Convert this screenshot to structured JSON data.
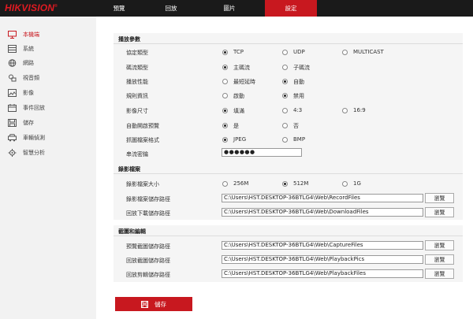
{
  "brand": {
    "name": "HIKVISION",
    "mark": "®"
  },
  "nav": {
    "tabs": [
      {
        "label": "預覽"
      },
      {
        "label": "回放"
      },
      {
        "label": "圖片"
      },
      {
        "label": "設定"
      }
    ]
  },
  "sidebar": {
    "items": [
      {
        "label": "本機端",
        "icon": "monitor-icon"
      },
      {
        "label": "系統",
        "icon": "system-icon"
      },
      {
        "label": "網路",
        "icon": "globe-icon"
      },
      {
        "label": "視音頻",
        "icon": "microphone-icon"
      },
      {
        "label": "影像",
        "icon": "image-icon"
      },
      {
        "label": "事件回放",
        "icon": "calendar-icon"
      },
      {
        "label": "儲存",
        "icon": "storage-icon"
      },
      {
        "label": "車輛偵測",
        "icon": "vehicle-icon"
      },
      {
        "label": "智慧分析",
        "icon": "analytics-icon"
      }
    ]
  },
  "playback_params": {
    "title": "播放參數",
    "protocol": {
      "label": "協定類型",
      "options": [
        "TCP",
        "UDP",
        "MULTICAST"
      ],
      "selected": "TCP"
    },
    "stream_type": {
      "label": "碼流類型",
      "options": [
        "主碼流",
        "子碼流"
      ],
      "selected": "主碼流"
    },
    "performance": {
      "label": "播放性能",
      "options": [
        "最短延時",
        "自動"
      ],
      "selected": "自動"
    },
    "rules": {
      "label": "規則資訊",
      "options": [
        "啟動",
        "禁用"
      ],
      "selected": "禁用"
    },
    "image_size": {
      "label": "影像尺寸",
      "options": [
        "填滿",
        "4:3",
        "16:9"
      ],
      "selected": "填滿"
    },
    "auto_preview": {
      "label": "自動開啟預覽",
      "options": [
        "是",
        "否"
      ],
      "selected": "是"
    },
    "capture_format": {
      "label": "抓圖檔案格式",
      "options": [
        "JPEG",
        "BMP"
      ],
      "selected": "JPEG"
    },
    "stream_password": {
      "label": "串流密鑰",
      "value": "●●●●●●"
    }
  },
  "record_files": {
    "title": "錄影檔案",
    "file_size": {
      "label": "錄影檔案大小",
      "options": [
        "256M",
        "512M",
        "1G"
      ],
      "selected": "512M"
    },
    "record_path": {
      "label": "錄影檔案儲存路徑",
      "value": "C:\\Users\\HST.DESKTOP-36BTLG4\\Web\\RecordFiles"
    },
    "download_path": {
      "label": "回放下載儲存路徑",
      "value": "C:\\Users\\HST.DESKTOP-36BTLG4\\Web\\DownloadFiles"
    }
  },
  "capture_clip": {
    "title": "截圖和編輯",
    "preview_capture": {
      "label": "預覽截圖儲存路徑",
      "value": "C:\\Users\\HST.DESKTOP-36BTLG4\\Web\\CaptureFiles"
    },
    "playback_capture": {
      "label": "回放截圖儲存路徑",
      "value": "C:\\Users\\HST.DESKTOP-36BTLG4\\Web\\PlaybackPics"
    },
    "playback_clip": {
      "label": "回放剪輯儲存路徑",
      "value": "C:\\Users\\HST.DESKTOP-36BTLG4\\Web\\PlaybackFiles"
    }
  },
  "buttons": {
    "browse": "瀏覽",
    "save": "儲存"
  },
  "colors": {
    "accent": "#c8181f",
    "topbar": "#1a1a1a",
    "sidebar": "#f2f2f2",
    "section": "#f5f5f5"
  }
}
